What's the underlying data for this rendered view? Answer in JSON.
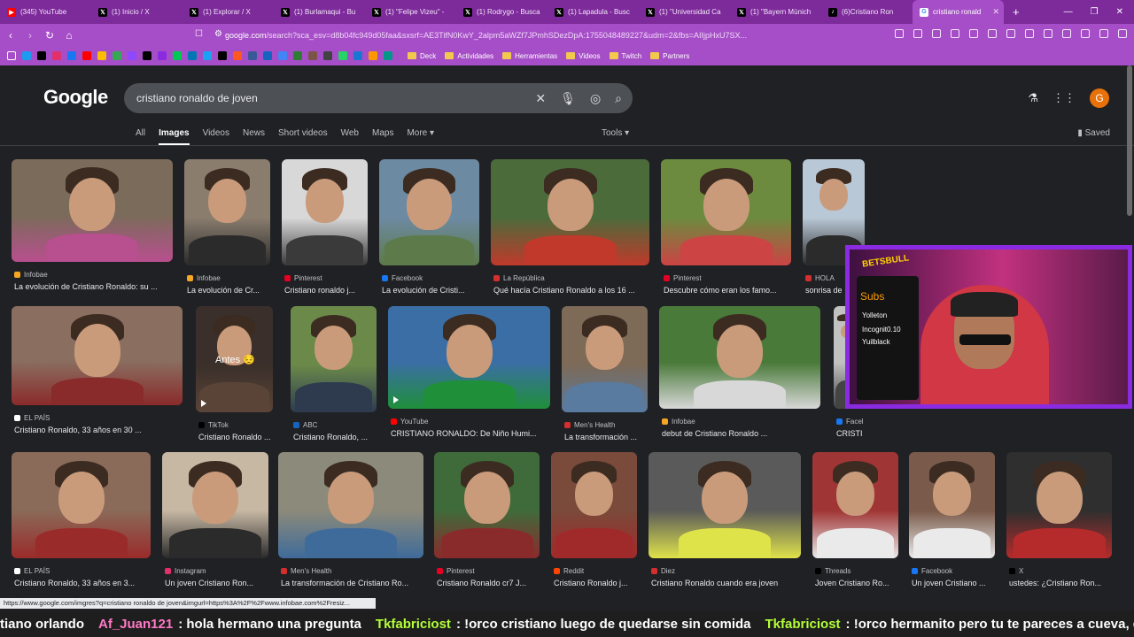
{
  "tabs": [
    {
      "label": "(345) YouTube",
      "icon": "youtube-icon",
      "color": "#ff0000"
    },
    {
      "label": "(1) Inicio / X",
      "icon": "x-icon",
      "color": "#000000"
    },
    {
      "label": "(1) Explorar / X",
      "icon": "x-icon",
      "color": "#000000"
    },
    {
      "label": "(1) Burlamaqui - Bu",
      "icon": "x-icon",
      "color": "#000000"
    },
    {
      "label": "(1) \"Felipe Vizeu\" -",
      "icon": "x-icon",
      "color": "#000000"
    },
    {
      "label": "(1) Rodrygo - Busca",
      "icon": "x-icon",
      "color": "#000000"
    },
    {
      "label": "(1) Lapadula - Busc",
      "icon": "x-icon",
      "color": "#000000"
    },
    {
      "label": "(1) \"Universidad Ca",
      "icon": "x-icon",
      "color": "#000000"
    },
    {
      "label": "(1) \"Bayern Münich",
      "icon": "x-icon",
      "color": "#000000"
    },
    {
      "label": "(6)Cristiano Ron",
      "icon": "tiktok-icon",
      "color": "#000000"
    },
    {
      "label": "cristiano ronald",
      "icon": "google-icon",
      "color": "#ffffff",
      "active": true
    }
  ],
  "address": {
    "url_host": "google.com",
    "url_rest": "/search?sca_esv=d8b04fc949d05faa&sxsrf=AE3TifN0KwY_2alpm5aWZf7JPmhSDezDpA:1755048489227&udm=2&fbs=AIIjpHxU7SX..."
  },
  "bookmarks": {
    "icon_colors": [
      "#1d9bf0",
      "#000000",
      "#e1306c",
      "#1877f2",
      "#ff0000",
      "#fbbc04",
      "#34a853",
      "#9146ff",
      "#000000",
      "#8a2be2",
      "#00c853",
      "#0077b5",
      "#1da1f2",
      "#000000",
      "#ff5722",
      "#3b5998",
      "#1565c0",
      "#4285f4",
      "#2e7d32",
      "#795548",
      "#424242",
      "#25d366",
      "#1976d2",
      "#ff9800",
      "#009688"
    ],
    "folders": [
      "Deck",
      "Actividades",
      "Herramientas",
      "Videos",
      "Twitch",
      "Partners"
    ]
  },
  "google": {
    "logo": "Google",
    "query": "cristiano ronaldo de joven",
    "tabs": [
      "All",
      "Images",
      "Videos",
      "News",
      "Short videos",
      "Web",
      "Maps",
      "More ▾"
    ],
    "active_tab": "Images",
    "tools": "Tools ▾",
    "saved": "Saved",
    "avatar_letter": "G"
  },
  "results": [
    {
      "source": "Infobae",
      "title": "La evolución de Cristiano Ronaldo: su ...",
      "src_color": "#f5a623"
    },
    {
      "source": "Infobae",
      "title": "La evolución de Cr...",
      "src_color": "#f5a623"
    },
    {
      "source": "Pinterest",
      "title": "Cristiano ronaldo j...",
      "src_color": "#e60023"
    },
    {
      "source": "Facebook",
      "title": "La evolución de Cristi...",
      "src_color": "#1877f2"
    },
    {
      "source": "La República",
      "title": "Qué hacía Cristiano Ronaldo a los 16 ...",
      "src_color": "#d32f2f"
    },
    {
      "source": "Pinterest",
      "title": "Descubre cómo eran los famo...",
      "src_color": "#e60023"
    },
    {
      "source": "HOLA",
      "title": "sonrisa de",
      "src_color": "#d32f2f"
    },
    {
      "source": "EL PAÍS",
      "title": "Cristiano Ronaldo, 33 años en 30 ...",
      "src_color": "#ffffff"
    },
    {
      "source": "TikTok",
      "title": "Cristiano Ronaldo ...",
      "src_color": "#000000"
    },
    {
      "source": "ABC",
      "title": "Cristiano Ronaldo, ...",
      "src_color": "#1565c0"
    },
    {
      "source": "YouTube",
      "title": "CRISTIANO RONALDO: De Niño Humi...",
      "src_color": "#ff0000"
    },
    {
      "source": "Men's Health",
      "title": "La transformación ...",
      "src_color": "#d32f2f"
    },
    {
      "source": "Infobae",
      "title": "debut de Cristiano Ronaldo ...",
      "src_color": "#f5a623"
    },
    {
      "source": "Facel",
      "title": "CRISTI",
      "src_color": "#1877f2"
    },
    {
      "source": "EL PAÍS",
      "title": "Cristiano Ronaldo, 33 años en 3...",
      "src_color": "#ffffff"
    },
    {
      "source": "Instagram",
      "title": "Un joven Cristiano Ron...",
      "src_color": "#e1306c"
    },
    {
      "source": "Men's Health",
      "title": "La transformación de Cristiano Ro...",
      "src_color": "#d32f2f"
    },
    {
      "source": "Pinterest",
      "title": "Cristiano Ronaldo cr7 J...",
      "src_color": "#e60023"
    },
    {
      "source": "Reddit",
      "title": "Cristiano Ronaldo j...",
      "src_color": "#ff4500"
    },
    {
      "source": "Diez",
      "title": "Cristiano Ronaldo cuando era joven",
      "src_color": "#d32f2f"
    },
    {
      "source": "Threads",
      "title": "Joven Cristiano Ro...",
      "src_color": "#000000"
    },
    {
      "source": "Facebook",
      "title": "Un joven Cristiano ...",
      "src_color": "#1877f2"
    },
    {
      "source": "X",
      "title": "ustedes: ¿Cristiano Ron...",
      "src_color": "#000000"
    }
  ],
  "thumb_text": {
    "antes": "Antes 😔"
  },
  "overlay": {
    "brand": "BETSBULL",
    "subs": "Subs",
    "lines": [
      "Yolleton",
      "Incognit0.10",
      "Yuilblack"
    ]
  },
  "status_url": "https://www.google.com/imgres?q=cristiano ronaldo de joven&imgurl=https%3A%2F%2Fwww.infobae.com%2Fresiz...",
  "ticker": [
    {
      "user": "",
      "msg": "tiano orlando"
    },
    {
      "user": "Af_Juan121",
      "msg": ": hola hermano una pregunta",
      "pink": true
    },
    {
      "user": "Tkfabriciost",
      "msg": ": !orco cristiano luego de quedarse sin comida"
    },
    {
      "user": "Tkfabriciost",
      "msg": ": !orco hermanito pero tu te pareces a cueva, que opinas"
    }
  ]
}
